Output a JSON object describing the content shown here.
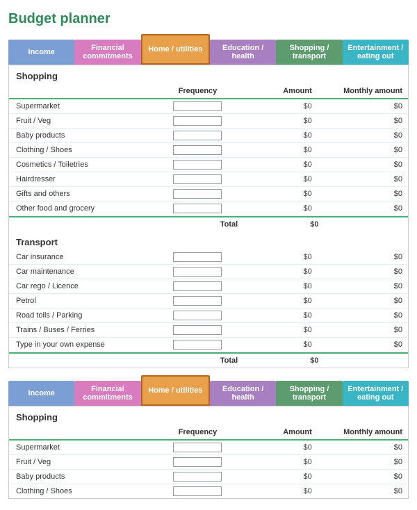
{
  "title": "Budget planner",
  "tabs": [
    {
      "id": "income",
      "label": "Income",
      "class": "tab-income"
    },
    {
      "id": "financial",
      "label": "Financial commitments",
      "class": "tab-financial"
    },
    {
      "id": "home",
      "label": "Home / utilities",
      "class": "tab-home"
    },
    {
      "id": "education",
      "label": "Education / health",
      "class": "tab-education"
    },
    {
      "id": "shopping",
      "label": "Shopping / transport",
      "class": "tab-shopping"
    },
    {
      "id": "entertainment",
      "label": "Entertainment / eating out",
      "class": "tab-entertainment"
    }
  ],
  "section1": {
    "title": "Shopping",
    "col_frequency": "Frequency",
    "col_amount": "Amount",
    "col_monthly": "Monthly amount",
    "rows": [
      {
        "label": "Supermarket",
        "amount": "$0",
        "monthly": "$0"
      },
      {
        "label": "Fruit / Veg",
        "amount": "$0",
        "monthly": "$0"
      },
      {
        "label": "Baby products",
        "amount": "$0",
        "monthly": "$0"
      },
      {
        "label": "Clothing / Shoes",
        "amount": "$0",
        "monthly": "$0"
      },
      {
        "label": "Cosmetics / Toiletries",
        "amount": "$0",
        "monthly": "$0"
      },
      {
        "label": "Hairdresser",
        "amount": "$0",
        "monthly": "$0"
      },
      {
        "label": "Gifts and others",
        "amount": "$0",
        "monthly": "$0"
      },
      {
        "label": "Other food and grocery",
        "amount": "$0",
        "monthly": "$0"
      }
    ],
    "total_label": "Total",
    "total_value": "$0"
  },
  "section2": {
    "title": "Transport",
    "rows": [
      {
        "label": "Car insurance",
        "amount": "$0",
        "monthly": "$0"
      },
      {
        "label": "Car maintenance",
        "amount": "$0",
        "monthly": "$0"
      },
      {
        "label": "Car rego / Licence",
        "amount": "$0",
        "monthly": "$0"
      },
      {
        "label": "Petrol",
        "amount": "$0",
        "monthly": "$0"
      },
      {
        "label": "Road tolls / Parking",
        "amount": "$0",
        "monthly": "$0"
      },
      {
        "label": "Trains / Buses / Ferries",
        "amount": "$0",
        "monthly": "$0"
      },
      {
        "label": "Type in your own expense",
        "amount": "$0",
        "monthly": "$0"
      }
    ],
    "total_label": "Total",
    "total_value": "$0"
  },
  "section3": {
    "title": "Shopping",
    "col_frequency": "Frequency",
    "col_amount": "Amount",
    "col_monthly": "Monthly amount",
    "rows": [
      {
        "label": "Supermarket",
        "amount": "$0",
        "monthly": "$0"
      },
      {
        "label": "Fruit / Veg",
        "amount": "$0",
        "monthly": "$0"
      },
      {
        "label": "Baby products",
        "amount": "$0",
        "monthly": "$0"
      },
      {
        "label": "Clothing / Shoes",
        "amount": "$0",
        "monthly": "$0"
      }
    ]
  }
}
